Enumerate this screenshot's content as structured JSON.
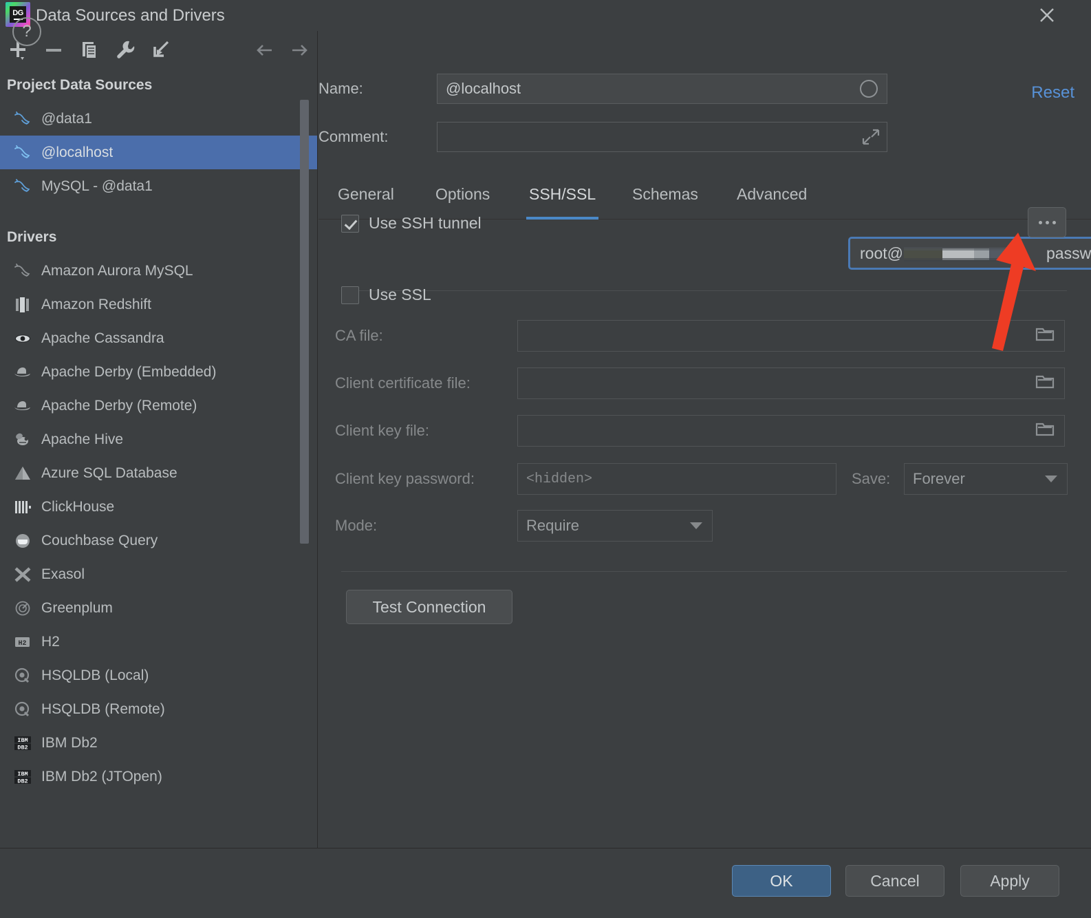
{
  "window": {
    "title": "Data Sources and Drivers",
    "app_icon": "datagrip-logo",
    "close_icon": "close-icon"
  },
  "left_panel": {
    "toolbar": [
      {
        "name": "add-data-source-button",
        "icon": "plus-icon"
      },
      {
        "name": "remove-data-source-button",
        "icon": "minus-icon"
      },
      {
        "name": "duplicate-data-source-button",
        "icon": "copy-icon"
      },
      {
        "name": "driver-properties-button",
        "icon": "wrench-icon"
      },
      {
        "name": "import-data-sources-button",
        "icon": "import-arrow-icon"
      },
      {
        "name": "navigate-back-button",
        "icon": "arrow-left-icon"
      },
      {
        "name": "navigate-forward-button",
        "icon": "arrow-right-icon"
      }
    ],
    "groups": [
      {
        "title": "Project Data Sources",
        "items": [
          {
            "label": "@data1",
            "icon": "mysql-dolphin-icon",
            "selected": false
          },
          {
            "label": "@localhost",
            "icon": "mysql-dolphin-icon",
            "selected": true
          },
          {
            "label": "MySQL - @data1",
            "icon": "mysql-dolphin-icon",
            "selected": false
          }
        ]
      },
      {
        "title": "Drivers",
        "items": [
          {
            "label": "Amazon Aurora MySQL",
            "icon": "mysql-dolphin-icon",
            "selected": false
          },
          {
            "label": "Amazon Redshift",
            "icon": "redshift-icon",
            "selected": false
          },
          {
            "label": "Apache Cassandra",
            "icon": "cassandra-eye-icon",
            "selected": false
          },
          {
            "label": "Apache Derby (Embedded)",
            "icon": "derby-hat-icon",
            "selected": false
          },
          {
            "label": "Apache Derby (Remote)",
            "icon": "derby-hat-icon",
            "selected": false
          },
          {
            "label": "Apache Hive",
            "icon": "hive-bee-icon",
            "selected": false
          },
          {
            "label": "Azure SQL Database",
            "icon": "azure-icon",
            "selected": false
          },
          {
            "label": "ClickHouse",
            "icon": "clickhouse-icon",
            "selected": false
          },
          {
            "label": "Couchbase Query",
            "icon": "couchbase-icon",
            "selected": false
          },
          {
            "label": "Exasol",
            "icon": "exasol-x-icon",
            "selected": false
          },
          {
            "label": "Greenplum",
            "icon": "greenplum-icon",
            "selected": false
          },
          {
            "label": "H2",
            "icon": "h2-icon",
            "selected": false
          },
          {
            "label": "HSQLDB (Local)",
            "icon": "hsqldb-icon",
            "selected": false
          },
          {
            "label": "HSQLDB (Remote)",
            "icon": "hsqldb-icon",
            "selected": false
          },
          {
            "label": "IBM Db2",
            "icon": "ibm-db2-icon",
            "selected": false
          },
          {
            "label": "IBM Db2 (JTOpen)",
            "icon": "ibm-db2-icon",
            "selected": false
          }
        ]
      }
    ]
  },
  "form": {
    "name_label": "Name:",
    "name_value": "@localhost",
    "name_adorn_icon": "color-circle-icon",
    "comment_label": "Comment:",
    "comment_value": "",
    "comment_adorn_icon": "expand-arrows-icon",
    "reset_label": "Reset"
  },
  "tabs": [
    {
      "label": "General",
      "active": false
    },
    {
      "label": "Options",
      "active": false
    },
    {
      "label": "SSH/SSL",
      "active": true
    },
    {
      "label": "Schemas",
      "active": false
    },
    {
      "label": "Advanced",
      "active": false
    }
  ],
  "ssh": {
    "checkbox_label": "Use SSH tunnel",
    "checked": true,
    "config_prefix": "root@",
    "config_redacted": true,
    "config_suffix": "password",
    "dropdown_icon": "chevron-down-icon",
    "more_button_icon": "ellipsis-icon"
  },
  "ssl": {
    "checkbox_label": "Use SSL",
    "checked": false,
    "fields": [
      {
        "label": "CA file:",
        "value": "",
        "icon": "folder-icon"
      },
      {
        "label": "Client certificate file:",
        "value": "",
        "icon": "folder-icon"
      },
      {
        "label": "Client key file:",
        "value": "",
        "icon": "folder-icon"
      }
    ],
    "key_password_label": "Client key password:",
    "key_password_placeholder": "<hidden>",
    "save_label": "Save:",
    "save_value": "Forever",
    "mode_label": "Mode:",
    "mode_value": "Require"
  },
  "actions": {
    "test_connection": "Test Connection",
    "help": "?",
    "ok": "OK",
    "cancel": "Cancel",
    "apply": "Apply"
  },
  "annotation": {
    "arrow_color": "#ee3c24",
    "points_at": "ssh-config-dropdown"
  },
  "colors": {
    "background": "#3c3f41",
    "selection": "#4b6eab",
    "accent_link": "#5892d8",
    "tab_underline": "#4a88c7",
    "focus_border": "#4a7ab5"
  }
}
